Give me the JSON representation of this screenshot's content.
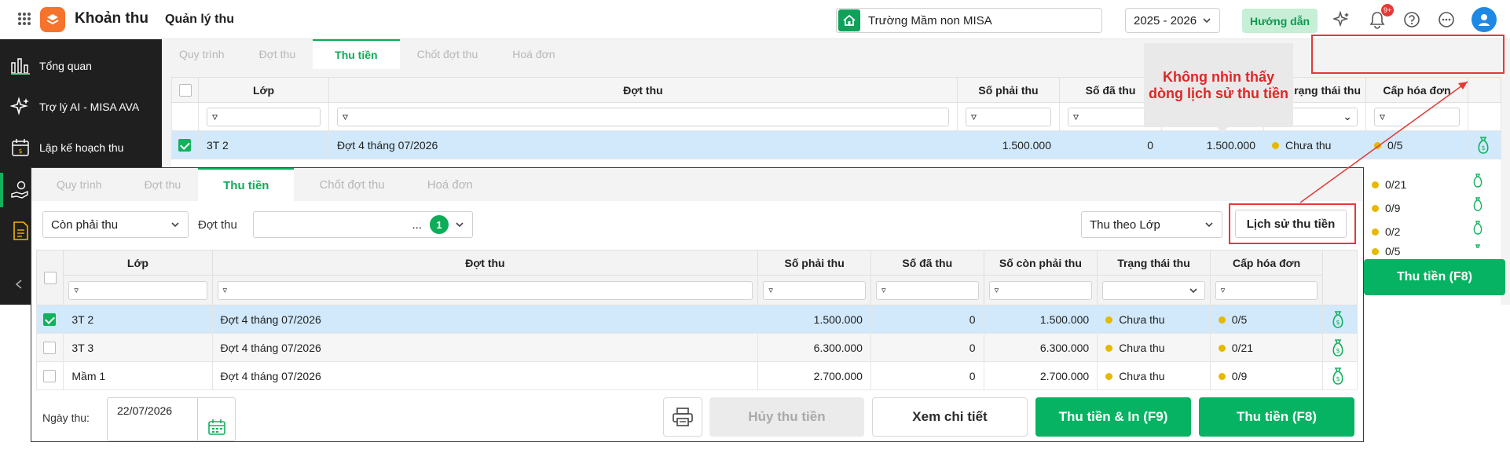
{
  "topbar": {
    "app_name": "Khoản thu",
    "page_title": "Quản lý thu",
    "school": "Trường Mầm non MISA",
    "year": "2025 - 2026",
    "guide_label": "Hướng dẫn",
    "notification_count": "9+"
  },
  "sidebar": {
    "items": [
      {
        "label": "Tổng quan",
        "icon": "chart-bars-icon"
      },
      {
        "label": "Trợ lý AI - MISA AVA",
        "icon": "sparkle-icon"
      },
      {
        "label": "Lập kế hoạch thu",
        "icon": "calendar-money-icon"
      },
      {
        "label": "",
        "icon": "hand-money-icon"
      },
      {
        "label": "",
        "icon": "document-icon"
      }
    ]
  },
  "back_window": {
    "tabs": [
      "Quy trình",
      "Đợt thu",
      "Thu tiền",
      "Chốt đợt thu",
      "Hoá đơn"
    ],
    "active_tab": "Thu tiền",
    "columns": [
      "Lớp",
      "Đợt thu",
      "Số phải thu",
      "Số đã thu",
      "Số còn phải thu",
      "Trạng thái thu",
      "Cấp hóa đơn"
    ],
    "column_partial": "rạng thái thu",
    "rows": [
      {
        "lop": "3T 2",
        "dot": "Đợt 4 tháng 07/2026",
        "phai": "1.500.000",
        "da": "0",
        "con": "1.500.000",
        "tt": "Chưa thu",
        "hd": "0/5"
      }
    ],
    "peek_hd": [
      "0/21",
      "0/9",
      "0/2",
      "0/5"
    ],
    "pay_button": "Thu tiền (F8)"
  },
  "annotation": {
    "text": "Không nhìn thấy dòng lịch sử thu tiền",
    "color": "#e53935"
  },
  "front_window": {
    "tabs": [
      "Quy trình",
      "Đợt thu",
      "Thu tiền",
      "Chốt đợt thu",
      "Hoá đơn"
    ],
    "active_tab": "Thu tiền",
    "status_filter": "Còn phải thu",
    "dot_label": "Đợt thu",
    "dot_value": "...",
    "dot_count": "1",
    "group_by": "Thu theo Lớp",
    "history_button": "Lịch sử thu tiền",
    "columns": [
      "Lớp",
      "Đợt thu",
      "Số phải thu",
      "Số đã thu",
      "Số còn phải thu",
      "Trạng thái thu",
      "Cấp hóa đơn"
    ],
    "rows": [
      {
        "lop": "3T 2",
        "dot": "Đợt 4 tháng 07/2026",
        "phai": "1.500.000",
        "da": "0",
        "con": "1.500.000",
        "tt": "Chưa thu",
        "hd": "0/5",
        "checked": true
      },
      {
        "lop": "3T 3",
        "dot": "Đợt 4 tháng 07/2026",
        "phai": "6.300.000",
        "da": "0",
        "con": "6.300.000",
        "tt": "Chưa thu",
        "hd": "0/21",
        "checked": false
      },
      {
        "lop": "Mầm 1",
        "dot": "Đợt 4 tháng 07/2026",
        "phai": "2.700.000",
        "da": "0",
        "con": "2.700.000",
        "tt": "Chưa thu",
        "hd": "0/9",
        "checked": false
      }
    ],
    "date_label": "Ngày thu:",
    "date_value": "22/07/2026",
    "cancel_label": "Hủy thu tiền",
    "detail_label": "Xem chi tiết",
    "pay_print_label": "Thu tiền & In (F9)",
    "pay_label": "Thu tiền (F8)"
  },
  "colors": {
    "brand": "#06b362",
    "accent_orange": "#f5732a",
    "annotation": "#e53935",
    "status_dot": "#e6b800"
  }
}
